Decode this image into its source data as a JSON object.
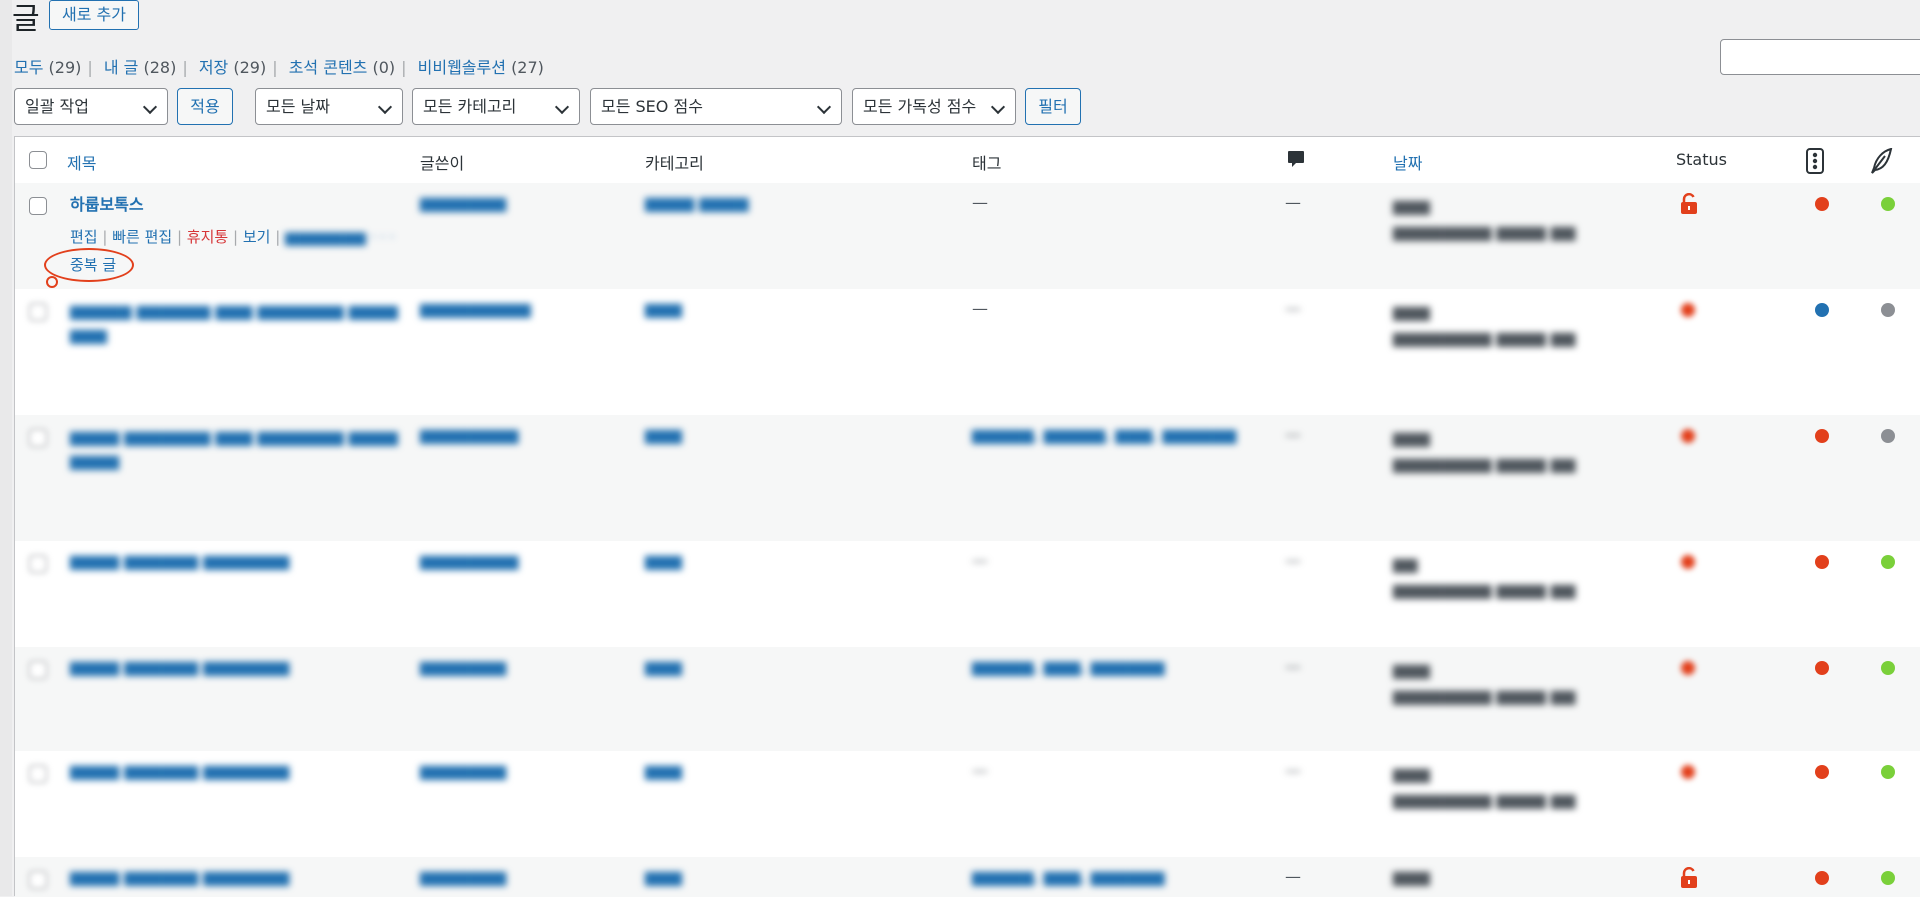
{
  "header": {
    "title": "글",
    "add_new": "새로 추가"
  },
  "views": [
    {
      "label": "모두",
      "count": "(29)"
    },
    {
      "label": "내 글",
      "count": "(28)"
    },
    {
      "label": "저장",
      "count": "(29)"
    },
    {
      "label": "초석 콘텐츠",
      "count": "(0)"
    },
    {
      "label": "비비웹솔루션",
      "count": "(27)"
    }
  ],
  "filters": {
    "bulk": "일괄 작업",
    "apply": "적용",
    "date": "모든 날짜",
    "category": "모든 카테고리",
    "seo": "모든 SEO 점수",
    "readability": "모든 가독성 점수",
    "filter": "필터"
  },
  "columns": {
    "title": "제목",
    "author": "글쓴이",
    "categories": "카테고리",
    "tags": "태그",
    "date": "날짜",
    "status": "Status"
  },
  "first_row": {
    "title": "하룹보톡스",
    "actions": {
      "edit": "편집",
      "quick_edit": "빠른 편집",
      "trash": "휴지통",
      "view": "보기",
      "duplicate": "중복 글"
    },
    "tag": "—",
    "comments": "—",
    "status_icon": "lock-icon",
    "seo_color": "#e2401c",
    "readability_color": "#7ad03a"
  },
  "rows": [
    {
      "tag": "—",
      "seo_color": "#2271b1",
      "readability_color": "#8c8f94"
    },
    {
      "seo_color": "#e2401c",
      "readability_color": "#8c8f94"
    },
    {
      "seo_color": "#e2401c",
      "readability_color": "#7ad03a"
    },
    {
      "seo_color": "#e2401c",
      "readability_color": "#7ad03a"
    },
    {
      "seo_color": "#e2401c",
      "readability_color": "#7ad03a"
    },
    {
      "tag_visible": "—",
      "seo_color": "#e2401c",
      "readability_color": "#7ad03a"
    }
  ],
  "colors": {
    "link": "#2271b1",
    "trash": "#d63638",
    "annotation": "#e2401c"
  }
}
